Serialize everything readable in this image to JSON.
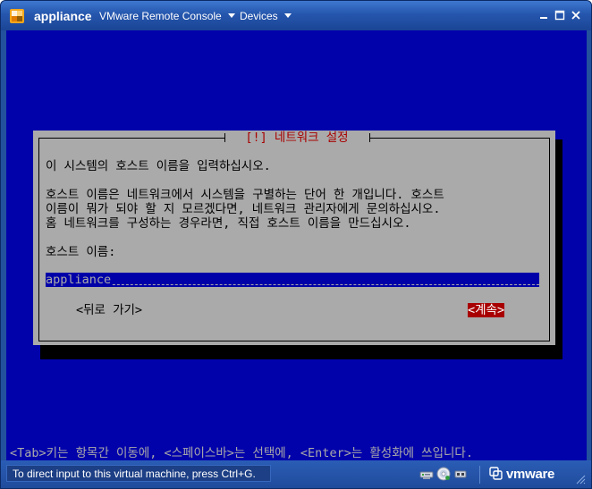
{
  "window": {
    "app_name": "appliance",
    "menus": [
      {
        "label": "VMware Remote Console"
      },
      {
        "label": "Devices"
      }
    ],
    "controls": {
      "minimize": "minimize-icon",
      "maximize": "maximize-icon",
      "close": "close-icon"
    }
  },
  "console": {
    "dialog": {
      "title": "[!] 네트워크 설정",
      "line1": "이 시스템의 호스트 이름을 입력하십시오.",
      "para": [
        "호스트 이름은 네트워크에서 시스템을 구별하는 단어 한 개입니다. 호스트",
        "이름이 뭐가 되야 할 지 모르겠다면, 네트워크 관리자에게 문의하십시오.",
        "홈 네트워크를 구성하는 경우라면, 직접 호스트 이름을 만드십시오."
      ],
      "field_label": "호스트 이름:",
      "field_value": "appliance",
      "back_button": "<뒤로 가기>",
      "continue_button": "<계속>"
    },
    "help_line": "<Tab>키는 항목간 이동에, <스페이스바>는 선택에, <Enter>는 활성화에 쓰입니다."
  },
  "statusbar": {
    "message": "To direct input to this virtual machine, press Ctrl+G.",
    "device_icons": [
      "network-adapter-icon",
      "cd-drive-icon",
      "usb-device-icon"
    ],
    "logo_text": "vmware"
  },
  "colors": {
    "console_bg": "#0202ab",
    "dialog_bg": "#aaaaaa",
    "title_red": "#a80000",
    "input_bg": "#0000a8",
    "titlebar_blue": "#2556ad"
  }
}
